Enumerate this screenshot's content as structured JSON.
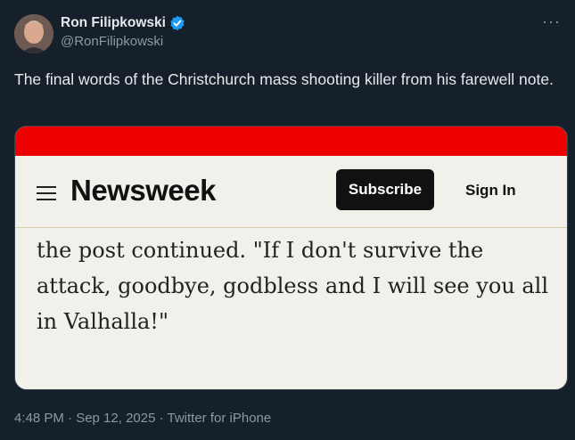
{
  "author": {
    "display_name": "Ron Filipkowski",
    "handle": "@RonFilipkowski"
  },
  "tweet": {
    "text": "The final words of the Christchurch mass shooting killer from his farewell note.",
    "meta": "4:48 PM · Sep 12, 2025 · Twitter for iPhone"
  },
  "embedded_screenshot": {
    "logo": "Newsweek",
    "subscribe_label": "Subscribe",
    "signin_label": "Sign In",
    "article_text": "the post continued. \"If I don't survive the attack, goodbye, godbless and I will see you all in Valhalla!\""
  },
  "colors": {
    "background": "#15202b",
    "verified_blue": "#1d9bf0",
    "newsweek_red": "#ee0000"
  }
}
